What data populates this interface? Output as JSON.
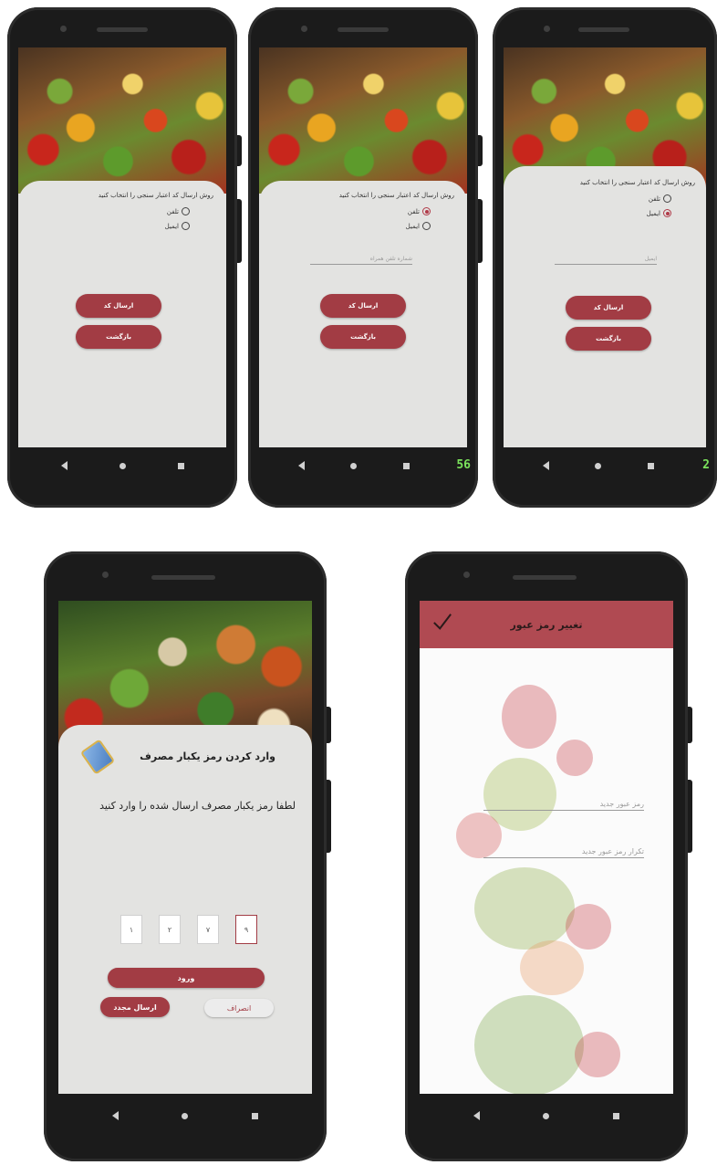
{
  "nav": {
    "counter_phone2": "56",
    "counter_phone3": "2"
  },
  "verification": {
    "prompt": "روش ارسال کد اعتبار سنجی را انتخاب کنید",
    "option_phone": "تلفن",
    "option_email": "ایمیل",
    "phone_placeholder": "شماره تلفن همراه",
    "email_placeholder": "ایمیل",
    "send_code_label": "ارسال کد",
    "back_label": "بازگشت"
  },
  "otp": {
    "title": "وارد کردن رمز یکبار مصرف",
    "subtitle": "لطفا رمز یکبار مصرف ارسال شده را وارد کنید",
    "digits": [
      "۱",
      "۲",
      "۷",
      "۹"
    ],
    "login_label": "ورود",
    "resend_label": "ارسال مجدد",
    "cancel_label": "انصراف"
  },
  "change_password": {
    "title": "تغییر رمز عبور",
    "new_password_placeholder": "رمز عبور جدید",
    "repeat_password_placeholder": "تکرار رمز عبور جدید"
  },
  "colors": {
    "accent": "#a23c44",
    "appbar": "#b04a52",
    "card": "#e3e3e1"
  }
}
